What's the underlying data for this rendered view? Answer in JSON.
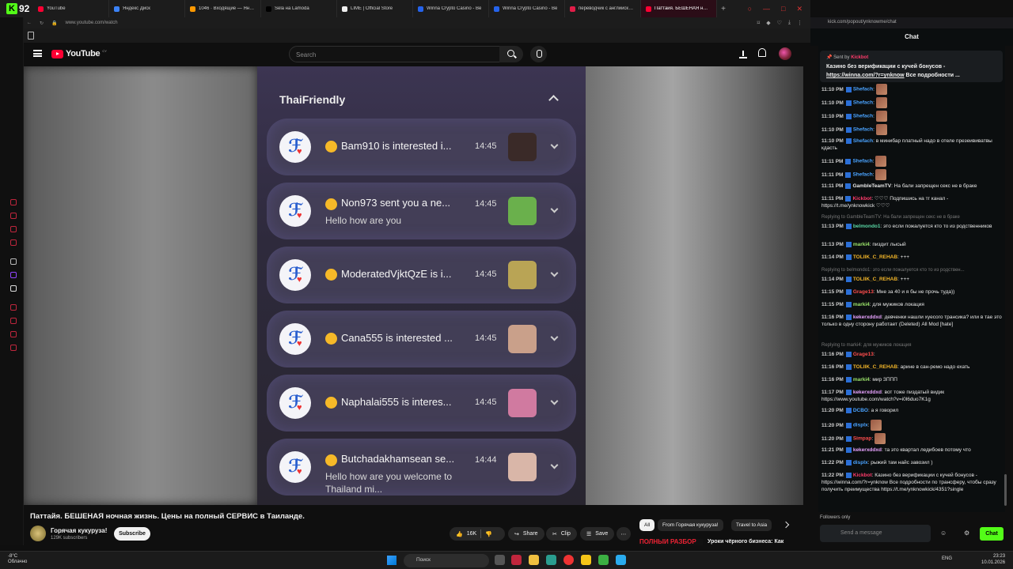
{
  "browser": {
    "badge_count": "92",
    "tabs": [
      {
        "label": "YouTube",
        "color": "#ff0033"
      },
      {
        "label": "Яндекс Диск",
        "color": "#3b82f6"
      },
      {
        "label": "1046 · Входящие — Янд…",
        "color": "#ff9900"
      },
      {
        "label": "Sela на Lamoda",
        "color": "#000000"
      },
      {
        "label": "LIME | Official Store",
        "color": "#eeeeee"
      },
      {
        "label": "Winna Crypto Casino - Be",
        "color": "#2563eb"
      },
      {
        "label": "Winna Crypto Casino - Be",
        "color": "#2563eb"
      },
      {
        "label": "переводчик с английско…",
        "color": "#e11d48"
      },
      {
        "label": "Паттайя. БЕШЕНАЯ н…",
        "color": "#ff0033"
      }
    ],
    "url": "www.youtube.com/watch"
  },
  "youtube": {
    "logo_text": "YouTube",
    "country_code": "CY",
    "search_placeholder": "Search",
    "video_title": "Паттайя. БЕШЕНАЯ ночная жизнь. Цены на полный СЕРВИС в Таиланде.",
    "channel_name": "Горячая кукуруза!",
    "channel_subs": "129K subscribers",
    "subscribe_label": "Subscribe",
    "likes": "16K",
    "share_label": "Share",
    "clip_label": "Clip",
    "save_label": "Save",
    "chips": [
      "All",
      "From Горячая кукуруза!",
      "Travel to Asia"
    ],
    "rec_thumb_text": "ПОЛНЫЙ РАЗБОР",
    "rec_title": "Уроки чёрного бизнеса: Как"
  },
  "video_content": {
    "group_title": "ThaiFriendly",
    "notifications": [
      {
        "title": "Bam910 is interested i...",
        "body": "",
        "time": "14:45",
        "thumb": "#3a2a28"
      },
      {
        "title": "Non973 sent you a ne...",
        "body": "Hello how are you",
        "time": "14:45",
        "thumb": "#6ab04c"
      },
      {
        "title": "ModeratedVjktQzE is i...",
        "body": "",
        "time": "14:45",
        "thumb": "#b9a455"
      },
      {
        "title": "Cana555 is interested ...",
        "body": "",
        "time": "14:45",
        "thumb": "#c9a08a"
      },
      {
        "title": "Naphalai555 is interes...",
        "body": "",
        "time": "14:45",
        "thumb": "#d07aa0"
      },
      {
        "title": "Butchadakhamsean se...",
        "body": "Hello how are you welcome to Thailand mi...",
        "time": "14:44",
        "thumb": "#d9b6a8"
      }
    ]
  },
  "chat": {
    "url": "kick.com/popout/ynknowme/chat",
    "title": "Chat",
    "pinned": {
      "sent_by": "Sent by",
      "user": "Kickbot",
      "text": "Казино без верификации с кучей бонусов -",
      "link": "https://winna.com/?r=ynknow",
      "suffix": "Все подробности ..."
    },
    "messages": [
      {
        "ts": "11:10 PM",
        "user": "Shefach",
        "color": "#4aa3ff",
        "text": ":",
        "emote": true
      },
      {
        "ts": "11:10 PM",
        "user": "Shefach",
        "color": "#4aa3ff",
        "text": ":",
        "emote": true
      },
      {
        "ts": "11:10 PM",
        "user": "Shefach",
        "color": "#4aa3ff",
        "text": ":",
        "emote": true
      },
      {
        "ts": "11:10 PM",
        "user": "Shefach",
        "color": "#4aa3ff",
        "text": ":",
        "emote": true
      },
      {
        "ts": "11:10 PM",
        "user": "Shefach",
        "color": "#4aa3ff",
        "text": ": в минибар платный надо в отеле презеививатвы кдасть"
      },
      {
        "ts": "11:11 PM",
        "user": "Shefach",
        "color": "#4aa3ff",
        "text": ":",
        "emote": true
      },
      {
        "ts": "11:11 PM",
        "user": "Shefach",
        "color": "#4aa3ff",
        "text": ":",
        "emote": true
      },
      {
        "ts": "11:11 PM",
        "user": "GambleTeamTV",
        "color": "#e8e8e8",
        "text": ": На бали запрещен секс не в браке"
      },
      {
        "ts": "11:11 PM",
        "user": "Kickbot",
        "color": "#ff3b6b",
        "text": ": ♡♡♡ Подпишись на тг канал - https://t.me/ynknowkick ♡♡♡"
      },
      {
        "reply": "Replying to GambleTeamTV: На бали запрещен секс не в браке"
      },
      {
        "ts": "11:13 PM",
        "user": "belmondo1",
        "color": "#59d6a5",
        "text": ": это если пожалуется кто то из родственников"
      },
      {
        "ts": "11:13 PM",
        "user": "marki4",
        "color": "#9be36a",
        "text": ": пиздит лысый"
      },
      {
        "ts": "11:14 PM",
        "user": "TOLIIK_C_REHAB",
        "color": "#f0b429",
        "text": ": +++"
      },
      {
        "reply": "Replying to belmondo1: это если пожалуется кто то из родствен..."
      },
      {
        "ts": "11:14 PM",
        "user": "TOLIIK_C_REHAB",
        "color": "#f0b429",
        "text": ": +++"
      },
      {
        "ts": "11:15 PM",
        "user": "Grage13",
        "color": "#ff4d4d",
        "text": ": Мне за 40 и я бы не прочь туда))"
      },
      {
        "ts": "11:15 PM",
        "user": "marki4",
        "color": "#9be36a",
        "text": ": для мужиков локация"
      },
      {
        "ts": "11:16 PM",
        "user": "kekerxddxd",
        "color": "#e8a3ff",
        "text": ": девченки нашли хуесого трансика? или в тае это только в одну сторону работает (Deleted) All Mod [hate]"
      },
      {
        "reply": "Replying to marki4: для мужиков локация"
      },
      {
        "ts": "11:16 PM",
        "user": "Grage13",
        "color": "#ff4d4d",
        "text": ":"
      },
      {
        "ts": "11:16 PM",
        "user": "TOLIIK_C_REHAB",
        "color": "#f0b429",
        "text": ": арине в сан-ремо надо ехать"
      },
      {
        "ts": "11:16 PM",
        "user": "marki4",
        "color": "#9be36a",
        "text": ": мир ЗППП"
      },
      {
        "ts": "11:17 PM",
        "user": "kekerxddxd",
        "color": "#e8a3ff",
        "text": ": вот тоже пиздатый видик https://www.youtube.com/watch?v=i0l6duo7K1g"
      },
      {
        "ts": "11:20 PM",
        "user": "DCBO",
        "color": "#4aa3ff",
        "text": ": а я говорил"
      },
      {
        "ts": "11:20 PM",
        "user": "displx",
        "color": "#4aa3ff",
        "text": ":",
        "emote": true
      },
      {
        "ts": "11:20 PM",
        "user": "Simpap",
        "color": "#ff4d4d",
        "text": ":",
        "emote": true
      },
      {
        "ts": "11:21 PM",
        "user": "kekerxddxd",
        "color": "#e8a3ff",
        "text": ": та это квартал ледибоев потому что"
      },
      {
        "ts": "11:22 PM",
        "user": "displx",
        "color": "#4aa3ff",
        "text": ": рыжий там найс завозил )"
      },
      {
        "ts": "11:22 PM",
        "user": "Kickbot",
        "color": "#ff3b6b",
        "text": ": Казино без верификации с кучей бонусов - https://winna.com/?r=ynknow Все подробности по трансферу, чтобы сразу получить преимущества https://t.me/ynknowkick/4351?single"
      }
    ],
    "followers_only": "Followers only",
    "input_placeholder": "Send a message",
    "send_label": "Chat"
  },
  "taskbar": {
    "weather_temp": "-8°C",
    "weather_desc": "Облачно",
    "search_placeholder": "Поиск",
    "lang": "ENG",
    "time": "23:23",
    "date": "10.01.2026"
  }
}
